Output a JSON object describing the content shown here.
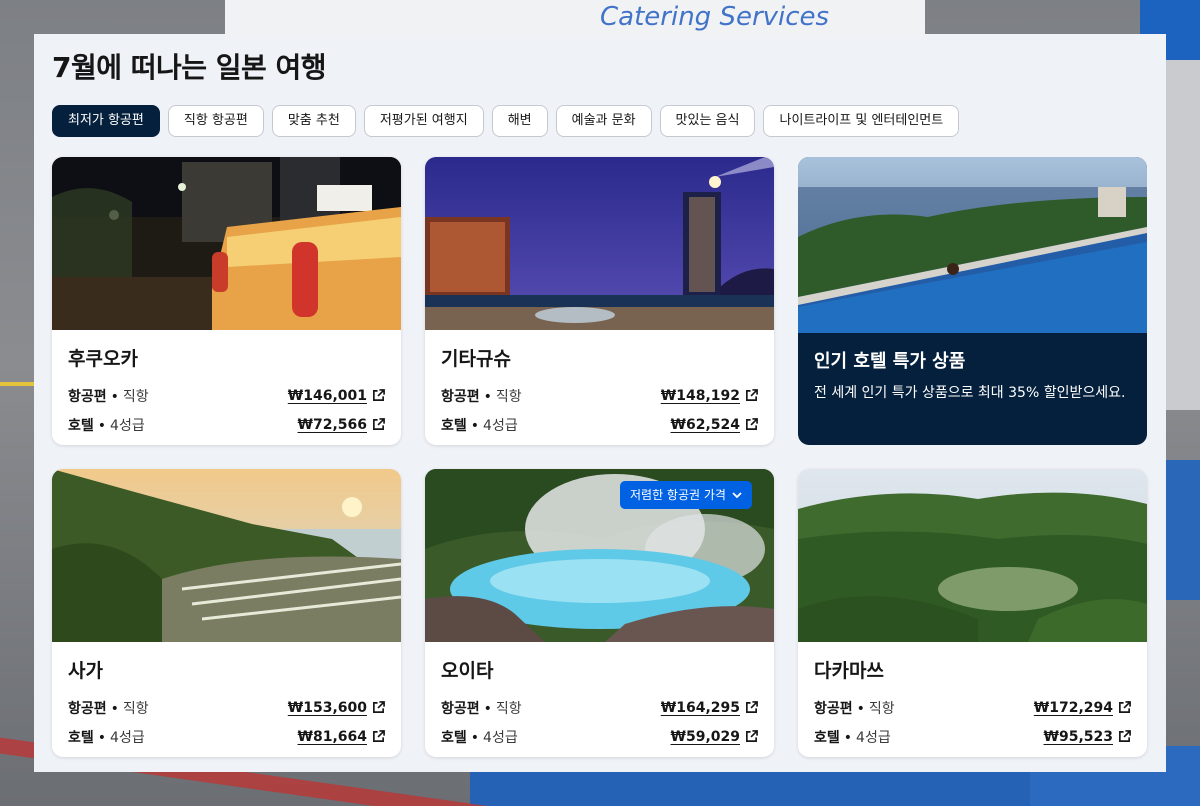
{
  "page": {
    "title": "7월에 떠나는 일본 여행"
  },
  "background": {
    "truck_text": "Catering Services"
  },
  "chips": [
    {
      "label": "최저가 항공편",
      "active": true
    },
    {
      "label": "직항 항공편"
    },
    {
      "label": "맞춤 추천"
    },
    {
      "label": "저평가된 여행지"
    },
    {
      "label": "해변"
    },
    {
      "label": "예술과 문화"
    },
    {
      "label": "맛있는 음식"
    },
    {
      "label": "나이트라이프 및 엔터테인먼트"
    }
  ],
  "labels": {
    "flight": "항공편",
    "flight_sub": "직항",
    "hotel": "호텔",
    "hotel_sub": "4성급",
    "separator": "•"
  },
  "cards": [
    {
      "city": "후쿠오카",
      "flight_price": "₩146,001",
      "hotel_price": "₩72,566"
    },
    {
      "city": "기타규슈",
      "flight_price": "₩148,192",
      "hotel_price": "₩62,524"
    },
    {
      "city": "사가",
      "flight_price": "₩153,600",
      "hotel_price": "₩81,664"
    },
    {
      "city": "오이타",
      "flight_price": "₩164,295",
      "hotel_price": "₩59,029",
      "badge": "저렴한 항공권 가격"
    },
    {
      "city": "다카마쓰",
      "flight_price": "₩172,294",
      "hotel_price": "₩95,523"
    }
  ],
  "promo": {
    "title": "인기 호텔 특가 상품",
    "description": "전 세계 인기 특가 상품으로 최대 35% 할인받으세요."
  },
  "colors": {
    "dark_navy": "#05203c",
    "accent_blue": "#0062e3",
    "panel_bg": "#eff2f7"
  }
}
